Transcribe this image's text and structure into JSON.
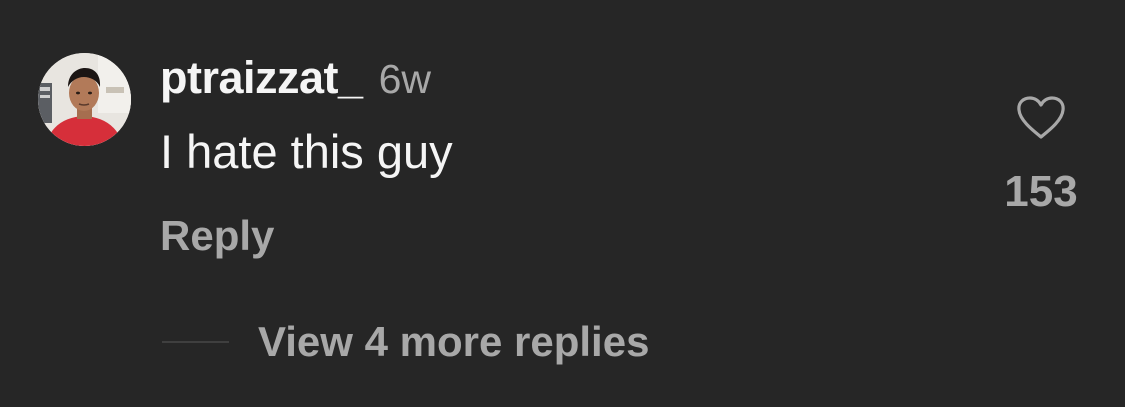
{
  "comment": {
    "avatar_icon": "user-profile-photo",
    "username": "ptraizzat_",
    "timestamp": "6w",
    "text": "I hate this guy",
    "reply_label": "Reply",
    "like_icon": "heart-outline-icon",
    "like_count": "153",
    "view_replies_label": "View 4 more replies"
  },
  "colors": {
    "background": "#262626",
    "primary_text": "#f5f5f5",
    "secondary_text": "#a8a8a8",
    "divider": "#3f3f3f"
  }
}
